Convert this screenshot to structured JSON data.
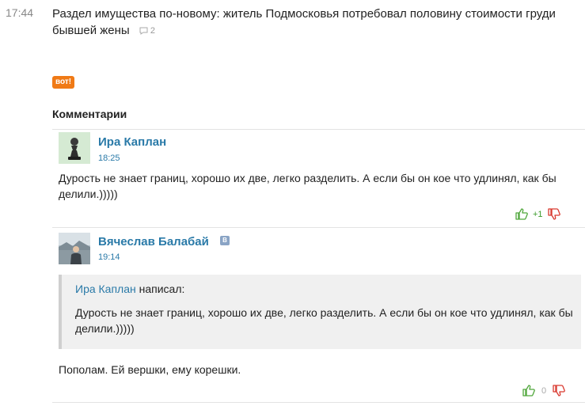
{
  "news": {
    "time": "17:44",
    "title": "Раздел имущества по-новому: житель Подмосковья потребовал половину стоимости груди бывшей жены",
    "comment_count": "2"
  },
  "vot_badge": "вот!",
  "comments_heading": "Комментарии",
  "comments": [
    {
      "author": "Ира Каплан",
      "time": "18:25",
      "text": "Дурость не знает границ, хорошо их две, легко разделить. А если бы он кое что удлинял, как бы делили.)))))",
      "score": "+1"
    },
    {
      "author": "Вячеслав Балабай",
      "network_badge": "В",
      "time": "19:14",
      "quote": {
        "author": "Ира Каплан",
        "wrote": "написал:",
        "text": "Дурость не знает границ, хорошо их две, легко разделить. А если бы он кое что удлинял, как бы делили.)))))"
      },
      "text": "Пополам. Ей вершки, ему корешки.",
      "score": "0"
    }
  ],
  "colors": {
    "link": "#2a7aa8",
    "badge": "#f07a16",
    "score_positive": "#3a9a2a",
    "thumb_up": "#4fa63a",
    "thumb_down": "#d9392f"
  }
}
